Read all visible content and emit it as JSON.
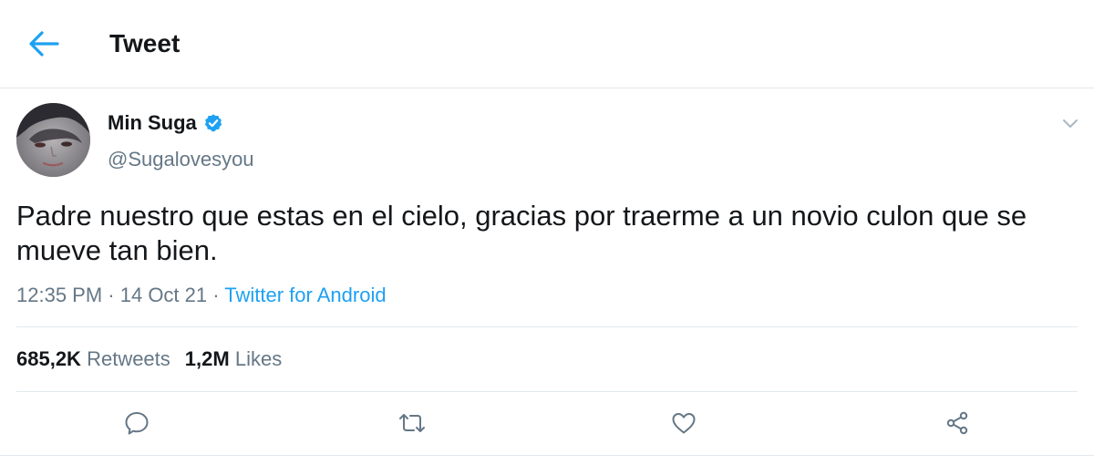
{
  "header": {
    "title": "Tweet",
    "back_icon": "arrow-left-icon"
  },
  "tweet": {
    "display_name": "Min Suga",
    "handle": "@Sugalovesyou",
    "verified": true,
    "text": "Padre nuestro que estas en el cielo, gracias por traerme a un novio culon que se mueve tan bien.",
    "time": "12:35 PM",
    "date": "14 Oct 21",
    "source": "Twitter for Android",
    "separator": " · "
  },
  "stats": {
    "retweets_count": "685,2K",
    "retweets_label": "Retweets",
    "likes_count": "1,2M",
    "likes_label": "Likes"
  },
  "actions": [
    {
      "icon": "reply-icon"
    },
    {
      "icon": "retweet-icon"
    },
    {
      "icon": "like-icon"
    },
    {
      "icon": "share-icon"
    }
  ],
  "colors": {
    "accent": "#1da1f2",
    "text": "#14171a",
    "secondary": "#657786",
    "divider": "#e1e8ed",
    "verified": "#1da1f2"
  }
}
